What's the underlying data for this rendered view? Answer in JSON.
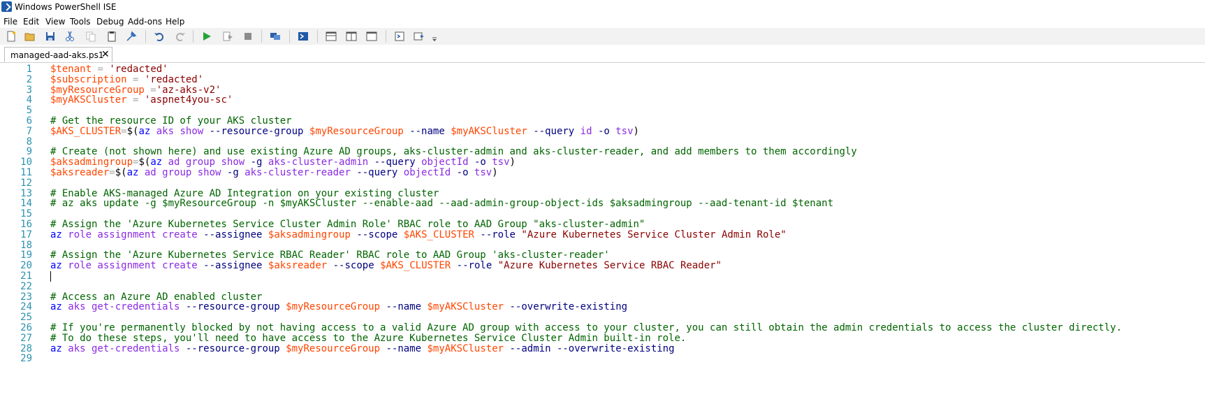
{
  "window": {
    "title": "Windows PowerShell ISE"
  },
  "menu": [
    "File",
    "Edit",
    "View",
    "Tools",
    "Debug",
    "Add-ons",
    "Help"
  ],
  "toolbar": {
    "buttons": [
      {
        "name": "new-icon"
      },
      {
        "name": "open-icon"
      },
      {
        "name": "save-icon"
      },
      {
        "name": "cut-icon"
      },
      {
        "name": "copy-icon"
      },
      {
        "name": "paste-icon"
      },
      {
        "name": "clear-console-icon"
      },
      {
        "name": "undo-icon"
      },
      {
        "name": "redo-icon"
      },
      {
        "name": "run-icon"
      },
      {
        "name": "run-selection-icon"
      },
      {
        "name": "stop-icon"
      },
      {
        "name": "remote-powershell-icon"
      },
      {
        "name": "powershell-console-icon"
      },
      {
        "name": "pane-top-icon"
      },
      {
        "name": "pane-right-icon"
      },
      {
        "name": "pane-max-icon"
      },
      {
        "name": "show-script-pane-icon"
      },
      {
        "name": "show-commands-icon"
      }
    ]
  },
  "tab": {
    "label": "managed-aad-aks.ps1",
    "close": "✕"
  },
  "colors": {
    "variable": "#ff4500",
    "string": "#8b0000",
    "comment": "#006400",
    "command": "#0000ff",
    "argument": "#8a2be2",
    "parameter": "#000080",
    "operator": "#a9a9a9",
    "default": "#000000",
    "line_number": "#2b91af"
  },
  "editor": {
    "lines": [
      {
        "n": "1",
        "t": [
          [
            "$tenant",
            "variable"
          ],
          [
            " = ",
            "operator"
          ],
          [
            "'redacted'",
            "string"
          ]
        ]
      },
      {
        "n": "2",
        "t": [
          [
            "$subscription",
            "variable"
          ],
          [
            " = ",
            "operator"
          ],
          [
            "'redacted'",
            "string"
          ]
        ]
      },
      {
        "n": "3",
        "t": [
          [
            "$myResourceGroup",
            "variable"
          ],
          [
            " =",
            "operator"
          ],
          [
            "'az-aks-v2'",
            "string"
          ]
        ]
      },
      {
        "n": "4",
        "t": [
          [
            "$myAKSCluster",
            "variable"
          ],
          [
            " = ",
            "operator"
          ],
          [
            "'aspnet4you-sc'",
            "string"
          ]
        ]
      },
      {
        "n": "5",
        "t": []
      },
      {
        "n": "6",
        "t": [
          [
            "# Get the resource ID of your AKS cluster",
            "comment"
          ]
        ]
      },
      {
        "n": "7",
        "t": [
          [
            "$AKS_CLUSTER",
            "variable"
          ],
          [
            "=",
            "operator"
          ],
          [
            "$(",
            "default"
          ],
          [
            "az",
            "command"
          ],
          [
            " aks show ",
            "argument"
          ],
          [
            "--resource-group",
            "parameter"
          ],
          [
            " ",
            "default"
          ],
          [
            "$myResourceGroup",
            "variable"
          ],
          [
            " ",
            "default"
          ],
          [
            "--name",
            "parameter"
          ],
          [
            " ",
            "default"
          ],
          [
            "$myAKSCluster",
            "variable"
          ],
          [
            " ",
            "default"
          ],
          [
            "--query",
            "parameter"
          ],
          [
            " id ",
            "argument"
          ],
          [
            "-o",
            "parameter"
          ],
          [
            " tsv",
            "argument"
          ],
          [
            ")",
            "default"
          ]
        ]
      },
      {
        "n": "8",
        "t": []
      },
      {
        "n": "9",
        "t": [
          [
            "# Create (not shown here) and use existing Azure AD groups, aks-cluster-admin and aks-cluster-reader, and add members to them accordingly",
            "comment"
          ]
        ]
      },
      {
        "n": "10",
        "t": [
          [
            "$aksadmingroup",
            "variable"
          ],
          [
            "=",
            "operator"
          ],
          [
            "$(",
            "default"
          ],
          [
            "az",
            "command"
          ],
          [
            " ad group show ",
            "argument"
          ],
          [
            "-g",
            "parameter"
          ],
          [
            " aks-cluster-admin ",
            "argument"
          ],
          [
            "--query",
            "parameter"
          ],
          [
            " objectId ",
            "argument"
          ],
          [
            "-o",
            "parameter"
          ],
          [
            " tsv",
            "argument"
          ],
          [
            ")",
            "default"
          ]
        ]
      },
      {
        "n": "11",
        "t": [
          [
            "$aksreader",
            "variable"
          ],
          [
            "=",
            "operator"
          ],
          [
            "$(",
            "default"
          ],
          [
            "az",
            "command"
          ],
          [
            " ad group show ",
            "argument"
          ],
          [
            "-g",
            "parameter"
          ],
          [
            " aks-cluster-reader ",
            "argument"
          ],
          [
            "--query",
            "parameter"
          ],
          [
            " objectId ",
            "argument"
          ],
          [
            "-o",
            "parameter"
          ],
          [
            " tsv",
            "argument"
          ],
          [
            ")",
            "default"
          ]
        ]
      },
      {
        "n": "12",
        "t": []
      },
      {
        "n": "13",
        "t": [
          [
            "# Enable AKS-managed Azure AD Integration on your existing cluster",
            "comment"
          ]
        ]
      },
      {
        "n": "14",
        "t": [
          [
            "# az aks update -g $myResourceGroup -n $myAKSCluster --enable-aad --aad-admin-group-object-ids $aksadmingroup --aad-tenant-id $tenant",
            "comment"
          ]
        ]
      },
      {
        "n": "15",
        "t": []
      },
      {
        "n": "16",
        "t": [
          [
            "# Assign the 'Azure Kubernetes Service Cluster Admin Role' RBAC role to AAD Group \"aks-cluster-admin\"",
            "comment"
          ]
        ]
      },
      {
        "n": "17",
        "t": [
          [
            "az",
            "command"
          ],
          [
            " role assignment create ",
            "argument"
          ],
          [
            "--assignee",
            "parameter"
          ],
          [
            " ",
            "default"
          ],
          [
            "$aksadmingroup",
            "variable"
          ],
          [
            " ",
            "default"
          ],
          [
            "--scope",
            "parameter"
          ],
          [
            " ",
            "default"
          ],
          [
            "$AKS_CLUSTER",
            "variable"
          ],
          [
            " ",
            "default"
          ],
          [
            "--role",
            "parameter"
          ],
          [
            " ",
            "default"
          ],
          [
            "\"Azure Kubernetes Service Cluster Admin Role\"",
            "string"
          ]
        ]
      },
      {
        "n": "18",
        "t": []
      },
      {
        "n": "19",
        "t": [
          [
            "# Assign the 'Azure Kubernetes Service RBAC Reader' RBAC role to AAD Group 'aks-cluster-reader'",
            "comment"
          ]
        ]
      },
      {
        "n": "20",
        "t": [
          [
            "az",
            "command"
          ],
          [
            " role assignment create ",
            "argument"
          ],
          [
            "--assignee",
            "parameter"
          ],
          [
            " ",
            "default"
          ],
          [
            "$aksreader",
            "variable"
          ],
          [
            " ",
            "default"
          ],
          [
            "--scope",
            "parameter"
          ],
          [
            " ",
            "default"
          ],
          [
            "$AKS_CLUSTER",
            "variable"
          ],
          [
            " ",
            "default"
          ],
          [
            "--role",
            "parameter"
          ],
          [
            " ",
            "default"
          ],
          [
            "\"Azure Kubernetes Service RBAC Reader\"",
            "string"
          ]
        ]
      },
      {
        "n": "21",
        "t": []
      },
      {
        "n": "22",
        "t": []
      },
      {
        "n": "23",
        "t": [
          [
            "# Access an Azure AD enabled cluster",
            "comment"
          ]
        ]
      },
      {
        "n": "24",
        "t": [
          [
            "az",
            "command"
          ],
          [
            " aks get-credentials ",
            "argument"
          ],
          [
            "--resource-group",
            "parameter"
          ],
          [
            " ",
            "default"
          ],
          [
            "$myResourceGroup",
            "variable"
          ],
          [
            " ",
            "default"
          ],
          [
            "--name",
            "parameter"
          ],
          [
            " ",
            "default"
          ],
          [
            "$myAKSCluster",
            "variable"
          ],
          [
            " ",
            "default"
          ],
          [
            "--overwrite-existing",
            "parameter"
          ]
        ]
      },
      {
        "n": "25",
        "t": []
      },
      {
        "n": "26",
        "t": [
          [
            "# If you're permanently blocked by not having access to a valid Azure AD group with access to your cluster, you can still obtain the admin credentials to access the cluster directly.",
            "comment"
          ]
        ]
      },
      {
        "n": "27",
        "t": [
          [
            "# To do these steps, you'll need to have access to the Azure Kubernetes Service Cluster Admin built-in role.",
            "comment"
          ]
        ]
      },
      {
        "n": "28",
        "t": [
          [
            "az",
            "command"
          ],
          [
            " aks get-credentials ",
            "argument"
          ],
          [
            "--resource-group",
            "parameter"
          ],
          [
            " ",
            "default"
          ],
          [
            "$myResourceGroup",
            "variable"
          ],
          [
            " ",
            "default"
          ],
          [
            "--name",
            "parameter"
          ],
          [
            " ",
            "default"
          ],
          [
            "$myAKSCluster",
            "variable"
          ],
          [
            " ",
            "default"
          ],
          [
            "--admin",
            "parameter"
          ],
          [
            " ",
            "default"
          ],
          [
            "--overwrite-existing",
            "parameter"
          ]
        ]
      },
      {
        "n": "29",
        "t": []
      }
    ]
  }
}
